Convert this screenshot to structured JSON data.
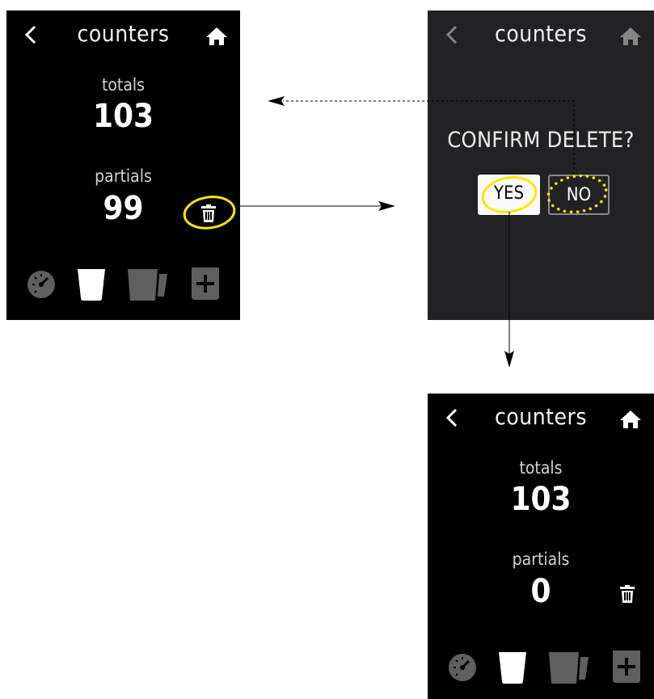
{
  "screens": {
    "before": {
      "title": "counters",
      "totals_label": "totals",
      "totals_value": "103",
      "partials_label": "partials",
      "partials_value": "99"
    },
    "confirm": {
      "title": "counters",
      "message": "CONFIRM DELETE?",
      "yes_label": "YES",
      "no_label": "NO"
    },
    "after": {
      "title": "counters",
      "totals_label": "totals",
      "totals_value": "103",
      "partials_label": "partials",
      "partials_value": "0"
    }
  },
  "icons": {
    "header": [
      "back-arrow-icon",
      "home-icon"
    ],
    "tabbar": [
      "speedometer-icon",
      "cup-icon",
      "jug-icon",
      "add-icon"
    ],
    "action": "trash-icon"
  },
  "colors": {
    "highlight": "#FFE600",
    "screen_bg": "#000000",
    "dialog_bg": "#222224",
    "tab_inactive": "#5f5f5f",
    "tab_active": "#ffffff"
  }
}
